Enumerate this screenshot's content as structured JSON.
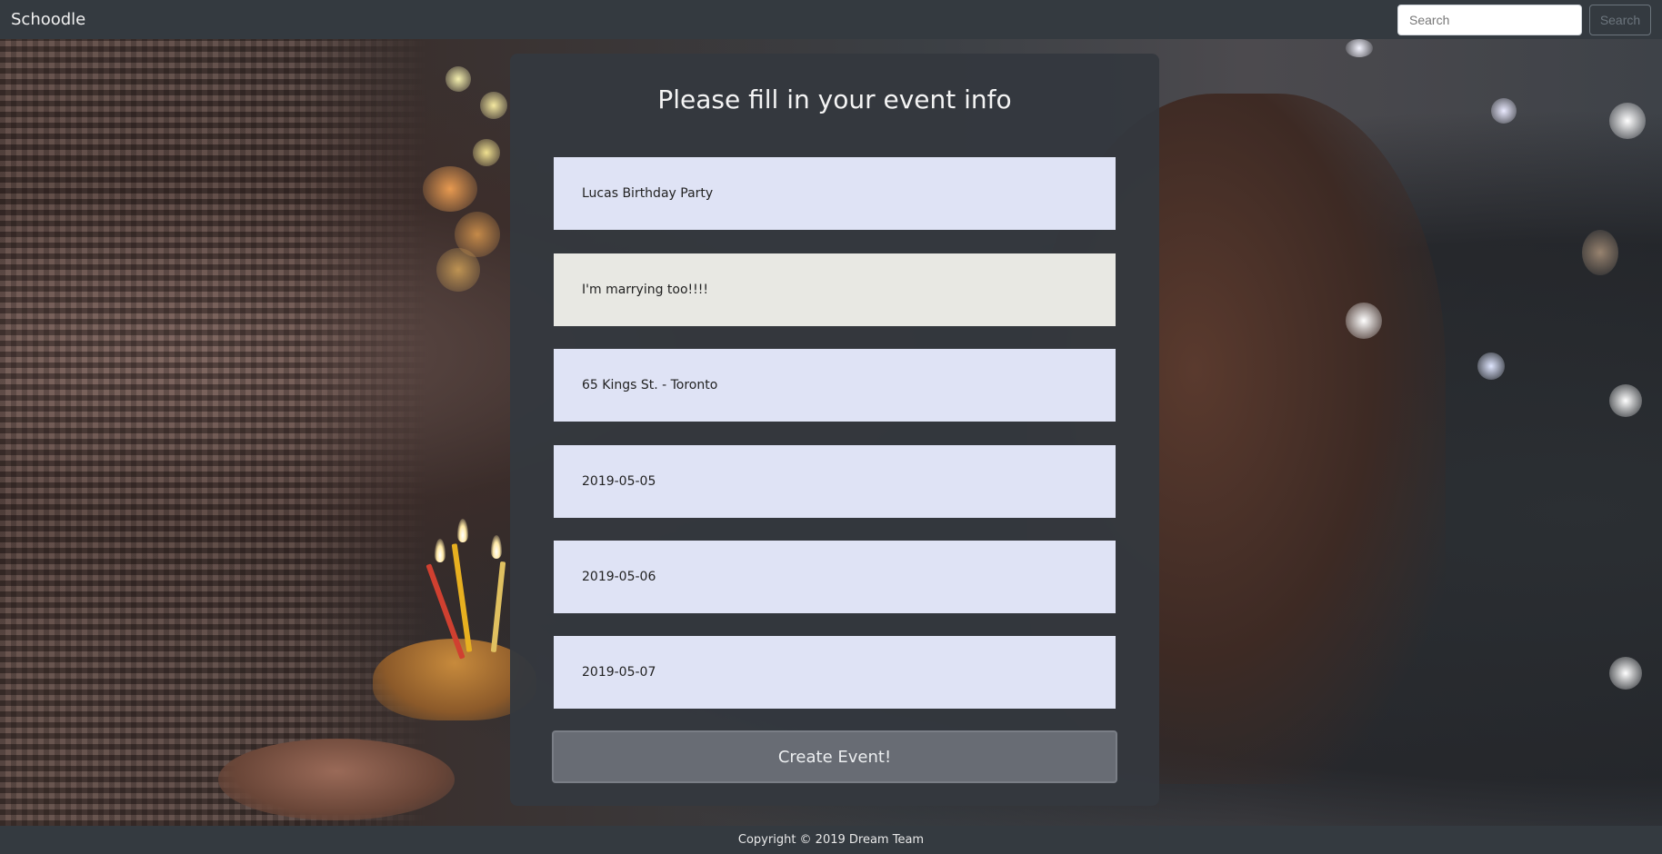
{
  "navbar": {
    "brand": "Schoodle",
    "search_placeholder": "Search",
    "search_button": "Search"
  },
  "form": {
    "title": "Please fill in your event info",
    "fields": [
      {
        "name": "event-name",
        "value": "Lucas Birthday Party"
      },
      {
        "name": "event-description",
        "value": "I'm marrying too!!!!"
      },
      {
        "name": "event-location",
        "value": "65 Kings St. - Toronto"
      },
      {
        "name": "event-date-1",
        "value": "2019-05-05"
      },
      {
        "name": "event-date-2",
        "value": "2019-05-06"
      },
      {
        "name": "event-date-3",
        "value": "2019-05-07"
      }
    ],
    "submit_label": "Create Event!"
  },
  "footer": {
    "copyright": "Copyright © 2019 Dream Team"
  }
}
